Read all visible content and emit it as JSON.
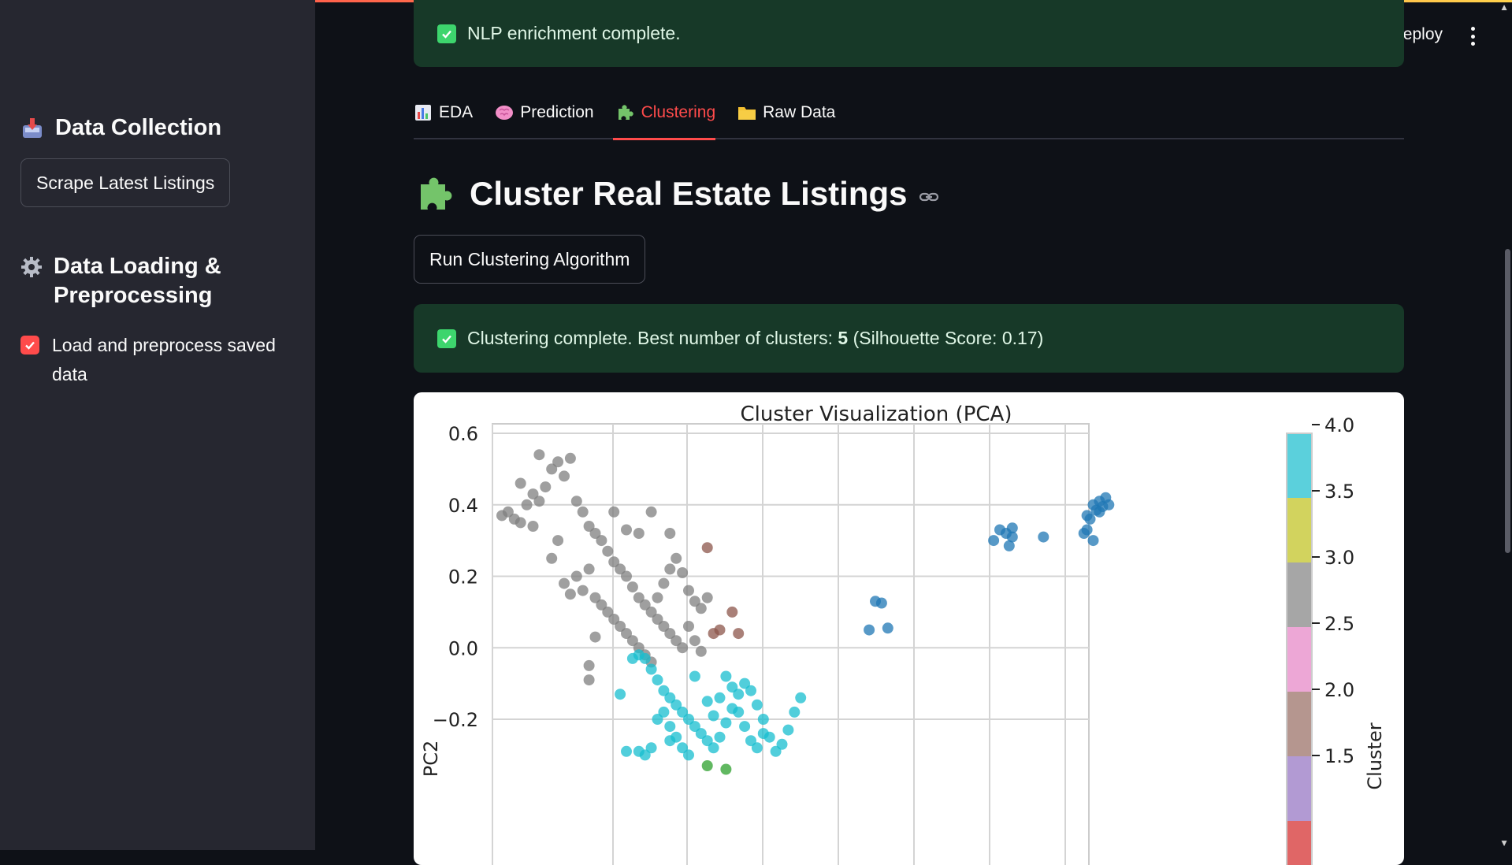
{
  "app": {
    "deploy_label": "Deploy"
  },
  "sidebar": {
    "data_collection": {
      "heading": "Data Collection",
      "button": "Scrape Latest Listings"
    },
    "data_loading": {
      "heading": "Data Loading & Preprocessing",
      "checkbox_label": "Load and preprocess saved data",
      "checked": true
    }
  },
  "alerts": {
    "nlp": "NLP enrichment complete.",
    "clustering_prefix": "Clustering complete. Best number of clusters: ",
    "clustering_best": "5",
    "clustering_suffix": " (Silhouette Score: 0.17)"
  },
  "tabs": [
    {
      "label": "EDA",
      "icon": "bar-chart-icon",
      "active": false
    },
    {
      "label": "Prediction",
      "icon": "brain-icon",
      "active": false
    },
    {
      "label": "Clustering",
      "icon": "puzzle-icon",
      "active": true
    },
    {
      "label": "Raw Data",
      "icon": "folder-icon",
      "active": false
    }
  ],
  "page": {
    "title": "Cluster Real Estate Listings",
    "run_button": "Run Clustering Algorithm"
  },
  "colors": {
    "accent": "#ff4b4b",
    "success_bg": "#173928",
    "cluster_blue": "#1f77b4",
    "cluster_gray": "#7f7f7f",
    "cluster_brown": "#8c564b",
    "cluster_cyan": "#17becf",
    "cluster_green": "#2ca02c"
  },
  "chart_data": {
    "type": "scatter",
    "title": "Cluster Visualization (PCA)",
    "xlabel": "",
    "ylabel": "PC2",
    "ylim": [
      -0.3,
      0.6
    ],
    "yticks": [
      "0.6",
      "0.4",
      "0.2",
      "0.0",
      "−0.2"
    ],
    "colorbar": {
      "label": "Cluster",
      "ticks": [
        "4.0",
        "3.5",
        "3.0",
        "2.5",
        "2.0",
        "1.5"
      ],
      "colors": [
        "#5bd0dc",
        "#d2d35e",
        "#a6a6a6",
        "#eda7d6",
        "#b5968f",
        "#b29ad3",
        "#e06666"
      ]
    },
    "grid": true,
    "series": [
      {
        "color": "#1f77b4",
        "points": [
          [
            0.95,
            0.4
          ],
          [
            0.96,
            0.41
          ],
          [
            0.97,
            0.42
          ],
          [
            0.955,
            0.385
          ],
          [
            0.965,
            0.395
          ],
          [
            0.94,
            0.37
          ],
          [
            0.945,
            0.36
          ],
          [
            0.975,
            0.4
          ],
          [
            0.96,
            0.38
          ],
          [
            0.935,
            0.32
          ],
          [
            0.94,
            0.33
          ],
          [
            0.95,
            0.3
          ],
          [
            0.8,
            0.33
          ],
          [
            0.81,
            0.32
          ],
          [
            0.82,
            0.31
          ],
          [
            0.79,
            0.3
          ],
          [
            0.815,
            0.285
          ],
          [
            0.82,
            0.335
          ],
          [
            0.87,
            0.31
          ],
          [
            0.6,
            0.13
          ],
          [
            0.61,
            0.125
          ],
          [
            0.59,
            0.05
          ],
          [
            0.62,
            0.055
          ]
        ]
      },
      {
        "color": "#7f7f7f",
        "points": [
          [
            0.0,
            0.37
          ],
          [
            0.01,
            0.38
          ],
          [
            0.02,
            0.36
          ],
          [
            0.03,
            0.35
          ],
          [
            0.04,
            0.4
          ],
          [
            0.05,
            0.43
          ],
          [
            0.06,
            0.41
          ],
          [
            0.07,
            0.45
          ],
          [
            0.08,
            0.5
          ],
          [
            0.09,
            0.52
          ],
          [
            0.1,
            0.48
          ],
          [
            0.11,
            0.53
          ],
          [
            0.06,
            0.54
          ],
          [
            0.03,
            0.46
          ],
          [
            0.12,
            0.41
          ],
          [
            0.13,
            0.38
          ],
          [
            0.14,
            0.34
          ],
          [
            0.15,
            0.32
          ],
          [
            0.16,
            0.3
          ],
          [
            0.17,
            0.27
          ],
          [
            0.18,
            0.24
          ],
          [
            0.19,
            0.22
          ],
          [
            0.2,
            0.2
          ],
          [
            0.21,
            0.17
          ],
          [
            0.22,
            0.14
          ],
          [
            0.23,
            0.12
          ],
          [
            0.24,
            0.1
          ],
          [
            0.25,
            0.08
          ],
          [
            0.26,
            0.06
          ],
          [
            0.27,
            0.04
          ],
          [
            0.28,
            0.02
          ],
          [
            0.29,
            0.0
          ],
          [
            0.14,
            0.22
          ],
          [
            0.12,
            0.2
          ],
          [
            0.1,
            0.18
          ],
          [
            0.11,
            0.15
          ],
          [
            0.13,
            0.16
          ],
          [
            0.15,
            0.14
          ],
          [
            0.16,
            0.12
          ],
          [
            0.17,
            0.1
          ],
          [
            0.18,
            0.08
          ],
          [
            0.19,
            0.06
          ],
          [
            0.2,
            0.04
          ],
          [
            0.21,
            0.02
          ],
          [
            0.22,
            0.0
          ],
          [
            0.23,
            -0.02
          ],
          [
            0.24,
            -0.04
          ],
          [
            0.25,
            0.14
          ],
          [
            0.26,
            0.18
          ],
          [
            0.27,
            0.22
          ],
          [
            0.28,
            0.25
          ],
          [
            0.29,
            0.21
          ],
          [
            0.3,
            0.16
          ],
          [
            0.31,
            0.13
          ],
          [
            0.32,
            0.11
          ],
          [
            0.33,
            0.14
          ],
          [
            0.3,
            0.06
          ],
          [
            0.31,
            0.02
          ],
          [
            0.32,
            -0.01
          ],
          [
            0.14,
            -0.05
          ],
          [
            0.14,
            -0.09
          ],
          [
            0.15,
            0.03
          ],
          [
            0.18,
            0.38
          ],
          [
            0.24,
            0.38
          ],
          [
            0.27,
            0.32
          ],
          [
            0.2,
            0.33
          ],
          [
            0.22,
            0.32
          ],
          [
            0.08,
            0.25
          ],
          [
            0.09,
            0.3
          ],
          [
            0.05,
            0.34
          ]
        ]
      },
      {
        "color": "#8c564b",
        "points": [
          [
            0.33,
            0.28
          ],
          [
            0.37,
            0.1
          ],
          [
            0.38,
            0.04
          ],
          [
            0.34,
            0.04
          ],
          [
            0.35,
            0.05
          ]
        ]
      },
      {
        "color": "#17becf",
        "points": [
          [
            0.21,
            -0.03
          ],
          [
            0.22,
            -0.02
          ],
          [
            0.23,
            -0.03
          ],
          [
            0.24,
            -0.06
          ],
          [
            0.25,
            -0.09
          ],
          [
            0.26,
            -0.12
          ],
          [
            0.27,
            -0.14
          ],
          [
            0.28,
            -0.16
          ],
          [
            0.29,
            -0.18
          ],
          [
            0.3,
            -0.2
          ],
          [
            0.31,
            -0.22
          ],
          [
            0.32,
            -0.24
          ],
          [
            0.33,
            -0.26
          ],
          [
            0.34,
            -0.28
          ],
          [
            0.35,
            -0.25
          ],
          [
            0.36,
            -0.21
          ],
          [
            0.37,
            -0.17
          ],
          [
            0.38,
            -0.13
          ],
          [
            0.39,
            -0.1
          ],
          [
            0.4,
            -0.12
          ],
          [
            0.41,
            -0.16
          ],
          [
            0.42,
            -0.2
          ],
          [
            0.43,
            -0.25
          ],
          [
            0.44,
            -0.29
          ],
          [
            0.45,
            -0.27
          ],
          [
            0.46,
            -0.23
          ],
          [
            0.47,
            -0.18
          ],
          [
            0.48,
            -0.14
          ],
          [
            0.26,
            -0.18
          ],
          [
            0.27,
            -0.22
          ],
          [
            0.28,
            -0.25
          ],
          [
            0.29,
            -0.28
          ],
          [
            0.3,
            -0.3
          ],
          [
            0.24,
            -0.28
          ],
          [
            0.23,
            -0.3
          ],
          [
            0.22,
            -0.29
          ],
          [
            0.2,
            -0.29
          ],
          [
            0.19,
            -0.13
          ],
          [
            0.31,
            -0.08
          ],
          [
            0.33,
            -0.15
          ],
          [
            0.34,
            -0.19
          ],
          [
            0.35,
            -0.14
          ],
          [
            0.36,
            -0.08
          ],
          [
            0.37,
            -0.11
          ],
          [
            0.38,
            -0.18
          ],
          [
            0.39,
            -0.22
          ],
          [
            0.4,
            -0.26
          ],
          [
            0.41,
            -0.28
          ],
          [
            0.42,
            -0.24
          ],
          [
            0.25,
            -0.2
          ],
          [
            0.27,
            -0.26
          ]
        ]
      },
      {
        "color": "#2ca02c",
        "points": [
          [
            0.33,
            -0.33
          ],
          [
            0.36,
            -0.34
          ]
        ]
      }
    ]
  }
}
